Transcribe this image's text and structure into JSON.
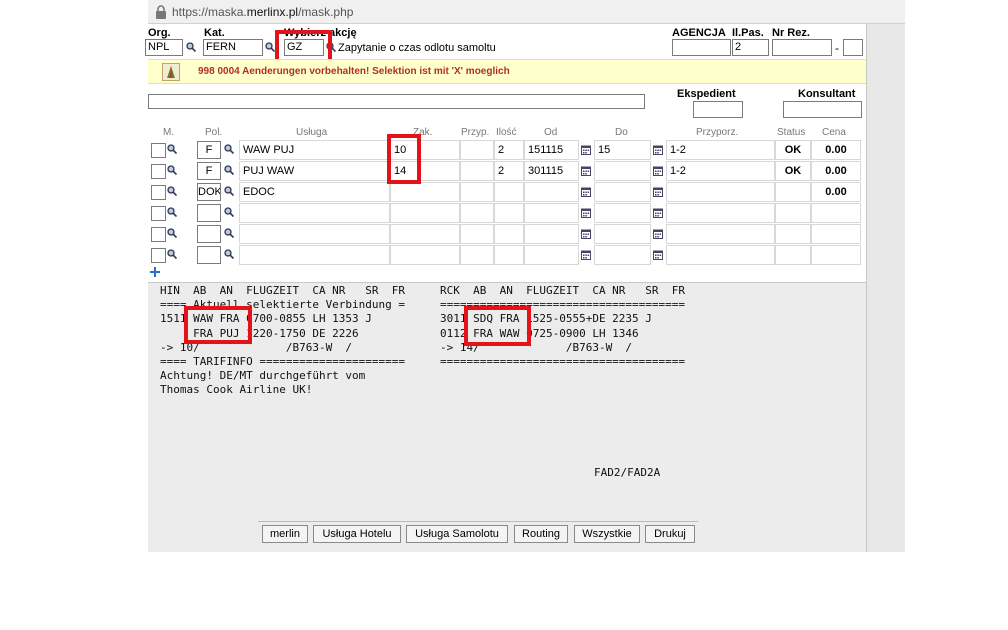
{
  "browser": {
    "url_prefix": "https://maska.",
    "url_domain": "merlinx.pl",
    "url_path": "/mask.php"
  },
  "header": {
    "org_label": "Org.",
    "org_value": "NPL",
    "kat_label": "Kat.",
    "kat_value": "FERN",
    "akcja_label": "Wybierz akcję",
    "akcja_value": "GZ",
    "akcja_desc": "Zapytanie o czas odlotu samoltu",
    "agencja_label": "AGENCJA",
    "ilpas_label": "Il.Pas.",
    "ilpas_value": "2",
    "nrrez_label": "Nr Rez.",
    "nrrez_sep": "-"
  },
  "banner": {
    "text": "998 0004 Aenderungen vorbehalten! Selektion ist mit 'X' moeglich"
  },
  "staff": {
    "ekspedient_label": "Ekspedient",
    "konsultant_label": "Konsultant"
  },
  "grid": {
    "headers": [
      "M.",
      "Pol.",
      "Usługa",
      "Zak.",
      "Przyp.",
      "Ilość",
      "Od",
      "Do",
      "Przyporz.",
      "Status",
      "Cena"
    ],
    "rows": [
      {
        "pol": "F",
        "usluga": "WAW PUJ",
        "zak": "10",
        "ilosc": "2",
        "od": "151115",
        "do": "15",
        "przyporz": "1-2",
        "status": "OK",
        "cena": "0.00"
      },
      {
        "pol": "F",
        "usluga": "PUJ WAW",
        "zak": "14",
        "ilosc": "2",
        "od": "301115",
        "do": "",
        "przyporz": "1-2",
        "status": "OK",
        "cena": "0.00"
      },
      {
        "pol": "DOK",
        "usluga": "EDOC",
        "zak": "",
        "ilosc": "",
        "od": "",
        "do": "",
        "przyporz": "",
        "status": "",
        "cena": "0.00"
      },
      {
        "pol": "",
        "usluga": "",
        "zak": "",
        "ilosc": "",
        "od": "",
        "do": "",
        "przyporz": "",
        "status": "",
        "cena": ""
      },
      {
        "pol": "",
        "usluga": "",
        "zak": "",
        "ilosc": "",
        "od": "",
        "do": "",
        "przyporz": "",
        "status": "",
        "cena": ""
      },
      {
        "pol": "",
        "usluga": "",
        "zak": "",
        "ilosc": "",
        "od": "",
        "do": "",
        "przyporz": "",
        "status": "",
        "cena": ""
      }
    ],
    "add_icon": "plus-icon"
  },
  "terminal": {
    "left": [
      "HIN  AB  AN  FLUGZEIT  CA NR   SR  FR",
      "==== Aktuell selektierte Verbindung =",
      "1511 WAW FRA 0700-0855 LH 1353 J",
      "     FRA PUJ 1220-1750 DE 2226",
      "-> 10/             /B763-W  /",
      "==== TARIFINFO ======================",
      "Achtung! DE/MT durchgeführt vom",
      "Thomas Cook Airline UK!"
    ],
    "right": [
      "RCK  AB  AN  FLUGZEIT  CA NR   SR  FR",
      "=====================================",
      "3011 SDQ FRA 1525-0555+DE 2235 J",
      "0112 FRA WAW 0725-0900 LH 1346",
      "-> 14/             /B763-W  /",
      "====================================="
    ],
    "footer_code": "FAD2/FAD2A"
  },
  "buttons": [
    "merlin",
    "Usługa Hotelu",
    "Usługa Samolotu",
    "Routing",
    "Wszystkie",
    "Drukuj"
  ]
}
